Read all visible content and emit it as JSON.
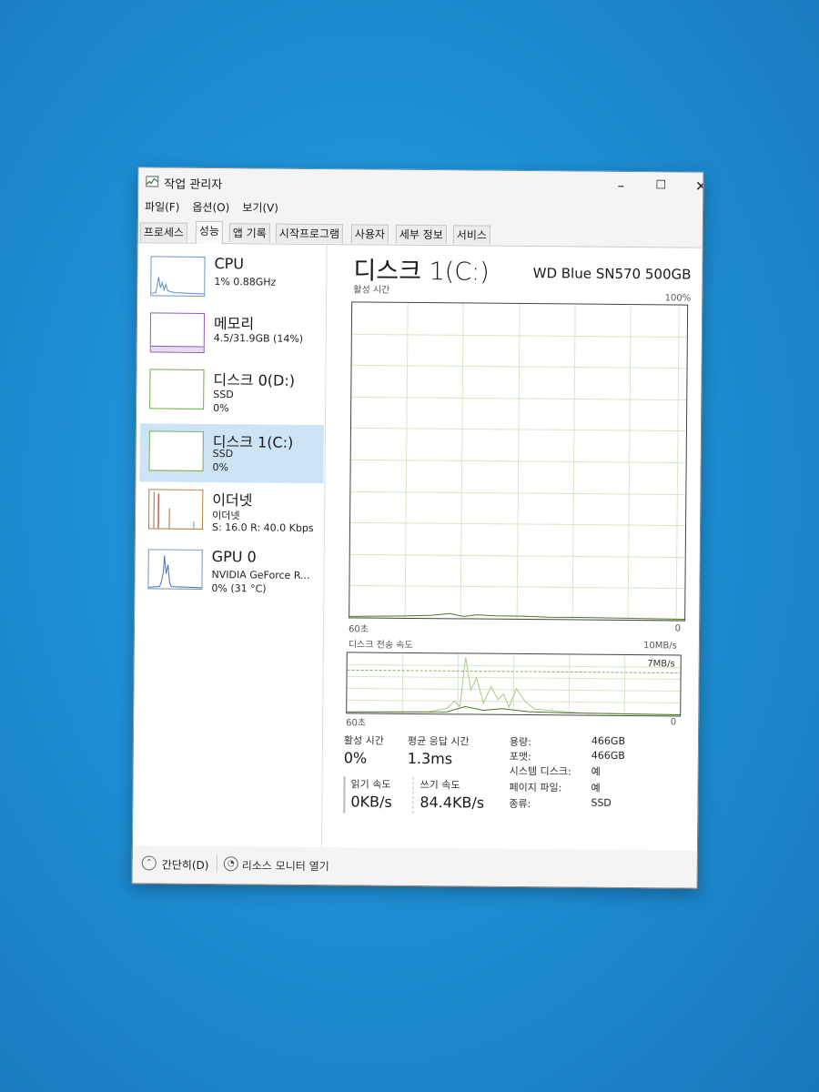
{
  "window": {
    "title": "작업 관리자",
    "minimize": "–",
    "maximize": "☐",
    "close": "✕"
  },
  "menu": {
    "file": "파일(F)",
    "options": "옵션(O)",
    "view": "보기(V)"
  },
  "tabs": [
    "프로세스",
    "성능",
    "앱 기록",
    "시작프로그램",
    "사용자",
    "세부 정보",
    "서비스"
  ],
  "sidebar": {
    "items": [
      {
        "name": "CPU",
        "line1": "1% 0.88GHz",
        "line2": ""
      },
      {
        "name": "메모리",
        "line1": "4.5/31.9GB (14%)",
        "line2": ""
      },
      {
        "name": "디스크 0(D:)",
        "line1": "SSD",
        "line2": "0%"
      },
      {
        "name": "디스크 1(C:)",
        "line1": "SSD",
        "line2": "0%"
      },
      {
        "name": "이더넷",
        "line1": "이더넷",
        "line2": "S: 16.0  R: 40.0 Kbps"
      },
      {
        "name": "GPU 0",
        "line1": "NVIDIA GeForce R...",
        "line2": "0% (31 °C)"
      }
    ]
  },
  "main": {
    "title": "디스크 1(C:)",
    "model": "WD Blue SN570 500GB",
    "active_label": "활성 시간",
    "active_max": "100%",
    "active_left": "60초",
    "active_right": "0",
    "transfer_label": "디스크 전송 속도",
    "transfer_max": "10MB/s",
    "transfer_mark": "7MB/s",
    "transfer_left": "60초",
    "transfer_right": "0",
    "stats": {
      "active_time_label": "활성 시간",
      "active_time_value": "0%",
      "avg_response_label": "평균 응답 시간",
      "avg_response_value": "1.3ms",
      "read_label": "읽기 속도",
      "read_value": "0KB/s",
      "write_label": "쓰기 속도",
      "write_value": "84.4KB/s"
    },
    "properties": {
      "capacity_label": "용량:",
      "capacity_value": "466GB",
      "formatted_label": "포맷:",
      "formatted_value": "466GB",
      "system_disk_label": "시스템 디스크:",
      "system_disk_value": "예",
      "page_file_label": "페이지 파일:",
      "page_file_value": "예",
      "type_label": "종류:",
      "type_value": "SSD"
    }
  },
  "footer": {
    "fewer_details": "간단히(D)",
    "resource_monitor": "리소스 모니터 열기"
  },
  "colors": {
    "accent": "#0078d7",
    "graph_line": "#4a7a24",
    "selected_bg": "#cde4f7",
    "disk_thumb": "#6f98c6"
  }
}
